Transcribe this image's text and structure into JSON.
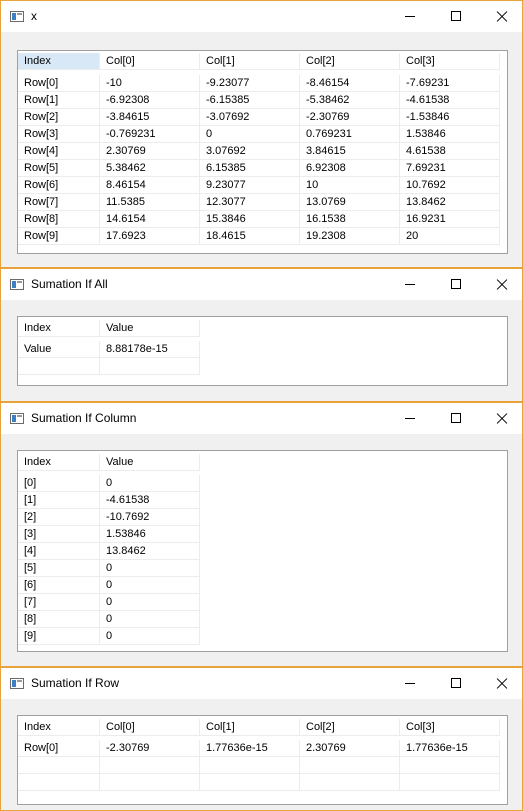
{
  "windows": [
    {
      "title": "x",
      "headers": [
        "Index",
        "Col[0]",
        "Col[1]",
        "Col[2]",
        "Col[3]"
      ],
      "rows": [
        [
          "Row[0]",
          "-10",
          "-9.23077",
          "-8.46154",
          "-7.69231"
        ],
        [
          "Row[1]",
          "-6.92308",
          "-6.15385",
          "-5.38462",
          "-4.61538"
        ],
        [
          "Row[2]",
          "-3.84615",
          "-3.07692",
          "-2.30769",
          "-1.53846"
        ],
        [
          "Row[3]",
          "-0.769231",
          "0",
          "0.769231",
          "1.53846"
        ],
        [
          "Row[4]",
          "2.30769",
          "3.07692",
          "3.84615",
          "4.61538"
        ],
        [
          "Row[5]",
          "5.38462",
          "6.15385",
          "6.92308",
          "7.69231"
        ],
        [
          "Row[6]",
          "8.46154",
          "9.23077",
          "10",
          "10.7692"
        ],
        [
          "Row[7]",
          "11.5385",
          "12.3077",
          "13.0769",
          "13.8462"
        ],
        [
          "Row[8]",
          "14.6154",
          "15.3846",
          "16.1538",
          "16.9231"
        ],
        [
          "Row[9]",
          "17.6923",
          "18.4615",
          "19.2308",
          "20"
        ]
      ]
    },
    {
      "title": "Sumation If All",
      "headers": [
        "Index",
        "Value"
      ],
      "rows": [
        [
          "Value",
          "8.88178e-15"
        ]
      ]
    },
    {
      "title": "Sumation If Column",
      "headers": [
        "Index",
        "Value"
      ],
      "rows": [
        [
          "[0]",
          "0"
        ],
        [
          "[1]",
          "-4.61538"
        ],
        [
          "[2]",
          "-10.7692"
        ],
        [
          "[3]",
          "1.53846"
        ],
        [
          "[4]",
          "13.8462"
        ],
        [
          "[5]",
          "0"
        ],
        [
          "[6]",
          "0"
        ],
        [
          "[7]",
          "0"
        ],
        [
          "[8]",
          "0"
        ],
        [
          "[9]",
          "0"
        ]
      ]
    },
    {
      "title": "Sumation If Row",
      "headers": [
        "Index",
        "Col[0]",
        "Col[1]",
        "Col[2]",
        "Col[3]"
      ],
      "rows": [
        [
          "Row[0]",
          "-2.30769",
          "1.77636e-15",
          "2.30769",
          "1.77636e-15"
        ]
      ]
    }
  ],
  "colors": {
    "accent_border": "#e8a33a",
    "selected_header": "#d9e8f7",
    "grid": "#ececec",
    "table_border": "#a0a0a0"
  },
  "icons": {
    "app": "app-window-icon",
    "minimize": "minimize-icon",
    "maximize": "maximize-icon",
    "close": "close-icon"
  }
}
